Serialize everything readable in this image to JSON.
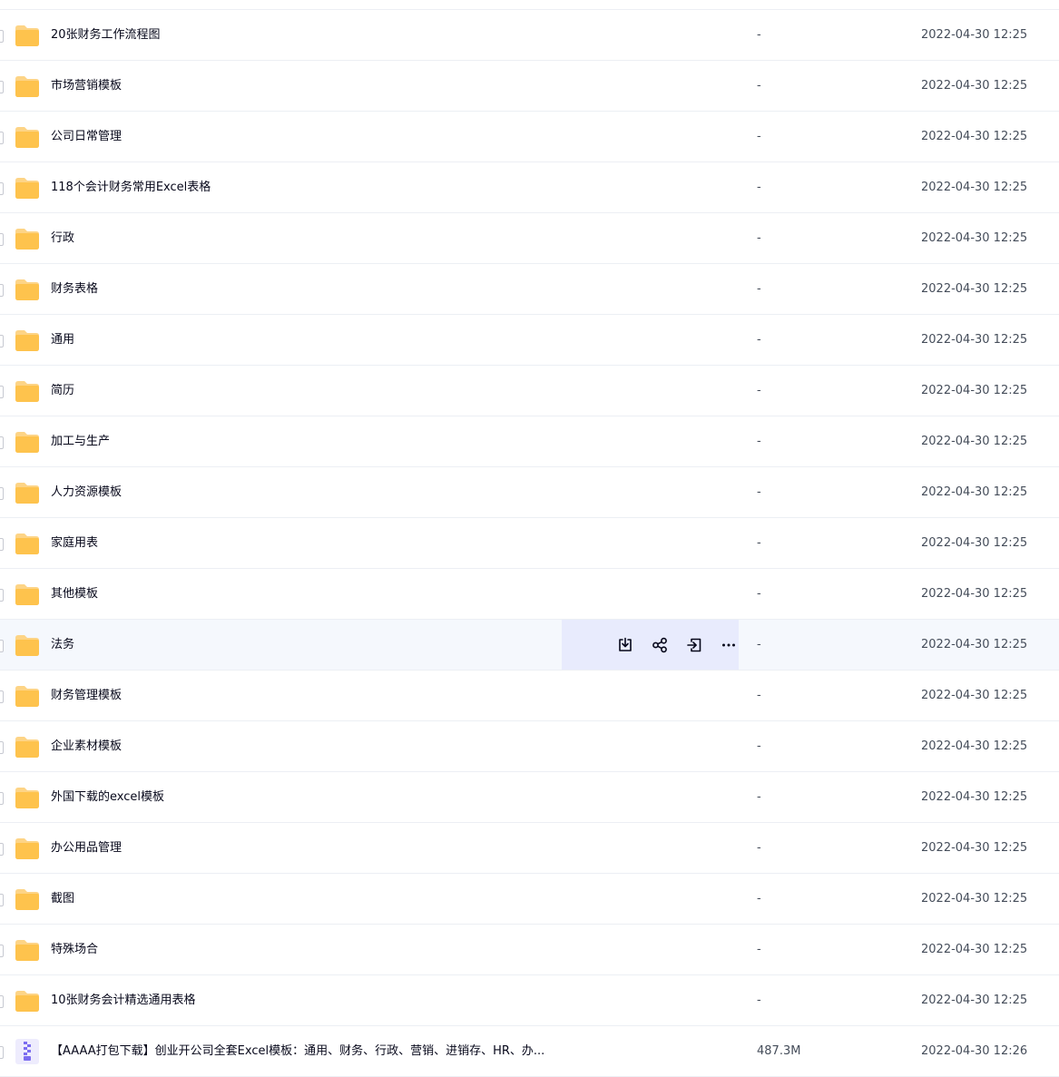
{
  "files": [
    {
      "name": "20张财务工作流程图",
      "size": "-",
      "mtime": "2022-04-30 12:25",
      "type": "folder"
    },
    {
      "name": "市场营销模板",
      "size": "-",
      "mtime": "2022-04-30 12:25",
      "type": "folder"
    },
    {
      "name": "公司日常管理",
      "size": "-",
      "mtime": "2022-04-30 12:25",
      "type": "folder"
    },
    {
      "name": "118个会计财务常用Excel表格",
      "size": "-",
      "mtime": "2022-04-30 12:25",
      "type": "folder"
    },
    {
      "name": "行政",
      "size": "-",
      "mtime": "2022-04-30 12:25",
      "type": "folder"
    },
    {
      "name": "财务表格",
      "size": "-",
      "mtime": "2022-04-30 12:25",
      "type": "folder"
    },
    {
      "name": "通用",
      "size": "-",
      "mtime": "2022-04-30 12:25",
      "type": "folder"
    },
    {
      "name": "简历",
      "size": "-",
      "mtime": "2022-04-30 12:25",
      "type": "folder"
    },
    {
      "name": "加工与生产",
      "size": "-",
      "mtime": "2022-04-30 12:25",
      "type": "folder"
    },
    {
      "name": "人力资源模板",
      "size": "-",
      "mtime": "2022-04-30 12:25",
      "type": "folder"
    },
    {
      "name": "家庭用表",
      "size": "-",
      "mtime": "2022-04-30 12:25",
      "type": "folder"
    },
    {
      "name": "其他模板",
      "size": "-",
      "mtime": "2022-04-30 12:25",
      "type": "folder"
    },
    {
      "name": "法务",
      "size": "-",
      "mtime": "2022-04-30 12:25",
      "type": "folder",
      "hovered": true
    },
    {
      "name": "财务管理模板",
      "size": "-",
      "mtime": "2022-04-30 12:25",
      "type": "folder"
    },
    {
      "name": "企业素材模板",
      "size": "-",
      "mtime": "2022-04-30 12:25",
      "type": "folder"
    },
    {
      "name": "外国下载的excel模板",
      "size": "-",
      "mtime": "2022-04-30 12:25",
      "type": "folder"
    },
    {
      "name": "办公用品管理",
      "size": "-",
      "mtime": "2022-04-30 12:25",
      "type": "folder"
    },
    {
      "name": "截图",
      "size": "-",
      "mtime": "2022-04-30 12:25",
      "type": "folder"
    },
    {
      "name": "特殊场合",
      "size": "-",
      "mtime": "2022-04-30 12:25",
      "type": "folder"
    },
    {
      "name": "10张财务会计精选通用表格",
      "size": "-",
      "mtime": "2022-04-30 12:25",
      "type": "folder"
    },
    {
      "name": "【AAAA打包下载】创业开公司全套Excel模板：通用、财务、行政、营销、进销存、HR、办...",
      "size": "487.3M",
      "mtime": "2022-04-30 12:26",
      "type": "zip"
    }
  ],
  "row_actions": [
    {
      "icon": "download-icon"
    },
    {
      "icon": "share-icon"
    },
    {
      "icon": "move-icon"
    },
    {
      "icon": "more-icon"
    }
  ],
  "colors": {
    "folder": "#fec34d",
    "folder_back": "#fdd486",
    "zip": "#7b6cf0",
    "hover_row": "#f5f8fd",
    "actions_bg": "#e8ebfd"
  }
}
